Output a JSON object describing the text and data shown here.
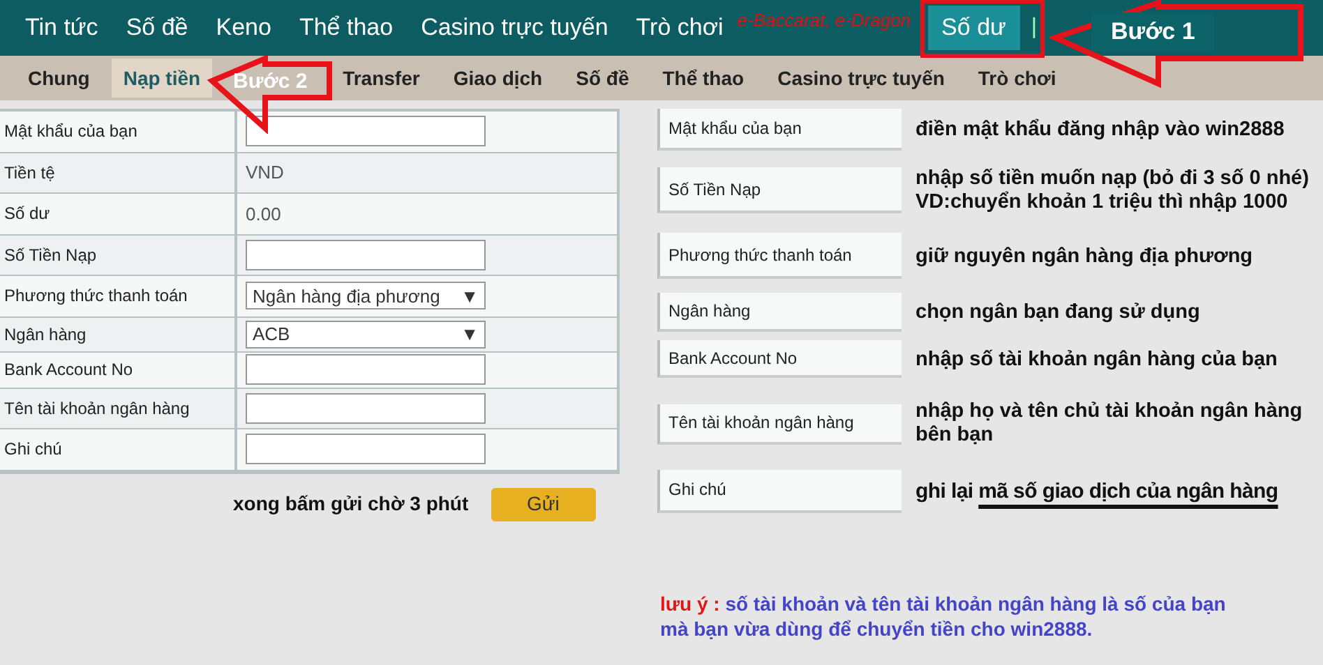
{
  "top_nav": [
    {
      "label": "Tin tức",
      "selected": false
    },
    {
      "label": "Số đề",
      "selected": false
    },
    {
      "label": "Keno",
      "selected": false
    },
    {
      "label": "Thể thao",
      "selected": false
    },
    {
      "label": "Casino trực tuyến",
      "selected": false
    },
    {
      "label": "Trò chơi",
      "selected": false
    },
    {
      "label": "Số dư",
      "selected": true
    }
  ],
  "top_nav_note": "e-Baccarat, e-Dragon",
  "top_nav_separator": "|",
  "sub_nav": [
    {
      "label": "Chung",
      "selected": false
    },
    {
      "label": "Nạp tiền",
      "selected": true
    },
    {
      "label": "Transfer",
      "selected": false
    },
    {
      "label": "Giao dịch",
      "selected": false
    },
    {
      "label": "Số đề",
      "selected": false
    },
    {
      "label": "Thể thao",
      "selected": false
    },
    {
      "label": "Casino trực tuyến",
      "selected": false
    },
    {
      "label": "Trò chơi",
      "selected": false
    }
  ],
  "form": {
    "rows": [
      {
        "label": "Mật khẩu của bạn",
        "kind": "input"
      },
      {
        "label": "Tiền tệ",
        "kind": "text",
        "value": "VND"
      },
      {
        "label": "Số dư",
        "kind": "text",
        "value": "0.00"
      },
      {
        "label": "Số Tiền Nạp",
        "kind": "input"
      },
      {
        "label": "Phương thức thanh toán",
        "kind": "select",
        "value": "Ngân hàng địa phương",
        "caret": "▼"
      },
      {
        "label": "Ngân hàng",
        "kind": "select",
        "value": "ACB",
        "caret": "▼"
      },
      {
        "label": "Bank Account No",
        "kind": "input"
      },
      {
        "label": "Tên tài khoản ngân hàng",
        "kind": "input"
      },
      {
        "label": "Ghi chú",
        "kind": "input"
      }
    ],
    "submit_note": "xong bấm gửi chờ 3 phút",
    "submit_button": "Gửi"
  },
  "guide": [
    {
      "label": "Mật khẩu của bạn",
      "note": "điền mật khẩu đăng nhập vào win2888"
    },
    {
      "label": "Số Tiền Nạp",
      "note": "nhập số tiền muốn nạp (bỏ đi 3 số 0 nhé)\nVD:chuyển khoản 1 triệu thì nhập 1000"
    },
    {
      "label": "Phương thức thanh toán",
      "note": "giữ nguyên ngân hàng địa phương"
    },
    {
      "label": "Ngân hàng",
      "note": "chọn ngân bạn đang sử dụng"
    },
    {
      "label": "Bank Account No",
      "note": "nhập số tài khoản ngân hàng của bạn"
    },
    {
      "label": "Tên tài khoản ngân hàng",
      "note": "nhập họ và tên chủ tài khoản ngân hàng\nbên bạn"
    },
    {
      "label": "Ghi chú",
      "note": "ghi lại ",
      "note_underlined": "mã số giao dịch của ngân hàng"
    }
  ],
  "warning": {
    "lead": "lưu ý :",
    "text": "số tài khoản và tên  tài khoản ngân hàng là số của bạn\nmà bạn vừa dùng để chuyển tiền cho win2888."
  },
  "annotations": [
    {
      "label": "Bước 1"
    },
    {
      "label": "Bước 2"
    }
  ]
}
